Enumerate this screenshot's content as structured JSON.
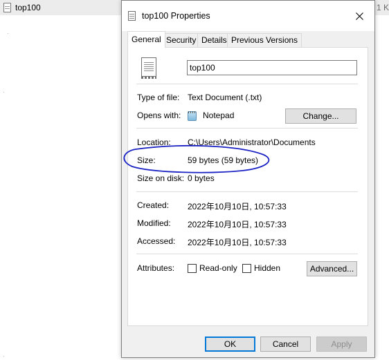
{
  "background": {
    "file_name": "top100",
    "size_fragment": "1 K"
  },
  "dialog": {
    "title": "top100 Properties",
    "tabs": [
      "General",
      "Security",
      "Details",
      "Previous Versions"
    ],
    "active_tab": "General",
    "file_name_value": "top100",
    "type_of_file": {
      "label": "Type of file:",
      "value": "Text Document (.txt)"
    },
    "opens_with": {
      "label": "Opens with:",
      "value": "Notepad",
      "change_button": "Change..."
    },
    "location": {
      "label": "Location:",
      "value": "C:\\Users\\Administrator\\Documents"
    },
    "size": {
      "label": "Size:",
      "value": "59 bytes (59 bytes)"
    },
    "size_on_disk": {
      "label": "Size on disk:",
      "value": "0 bytes"
    },
    "created": {
      "label": "Created:",
      "value": "2022年10月10日, 10:57:33"
    },
    "modified": {
      "label": "Modified:",
      "value": "2022年10月10日, 10:57:33"
    },
    "accessed": {
      "label": "Accessed:",
      "value": "2022年10月10日, 10:57:33"
    },
    "attributes": {
      "label": "Attributes:",
      "read_only": {
        "label": "Read-only",
        "checked": false
      },
      "hidden": {
        "label": "Hidden",
        "checked": false
      },
      "advanced_button": "Advanced..."
    },
    "buttons": {
      "ok": "OK",
      "cancel": "Cancel",
      "apply": "Apply"
    }
  },
  "colors": {
    "annotation": "#1a22c4",
    "default_button_border": "#0078d7",
    "dialog_background": "#f0f0f0"
  }
}
